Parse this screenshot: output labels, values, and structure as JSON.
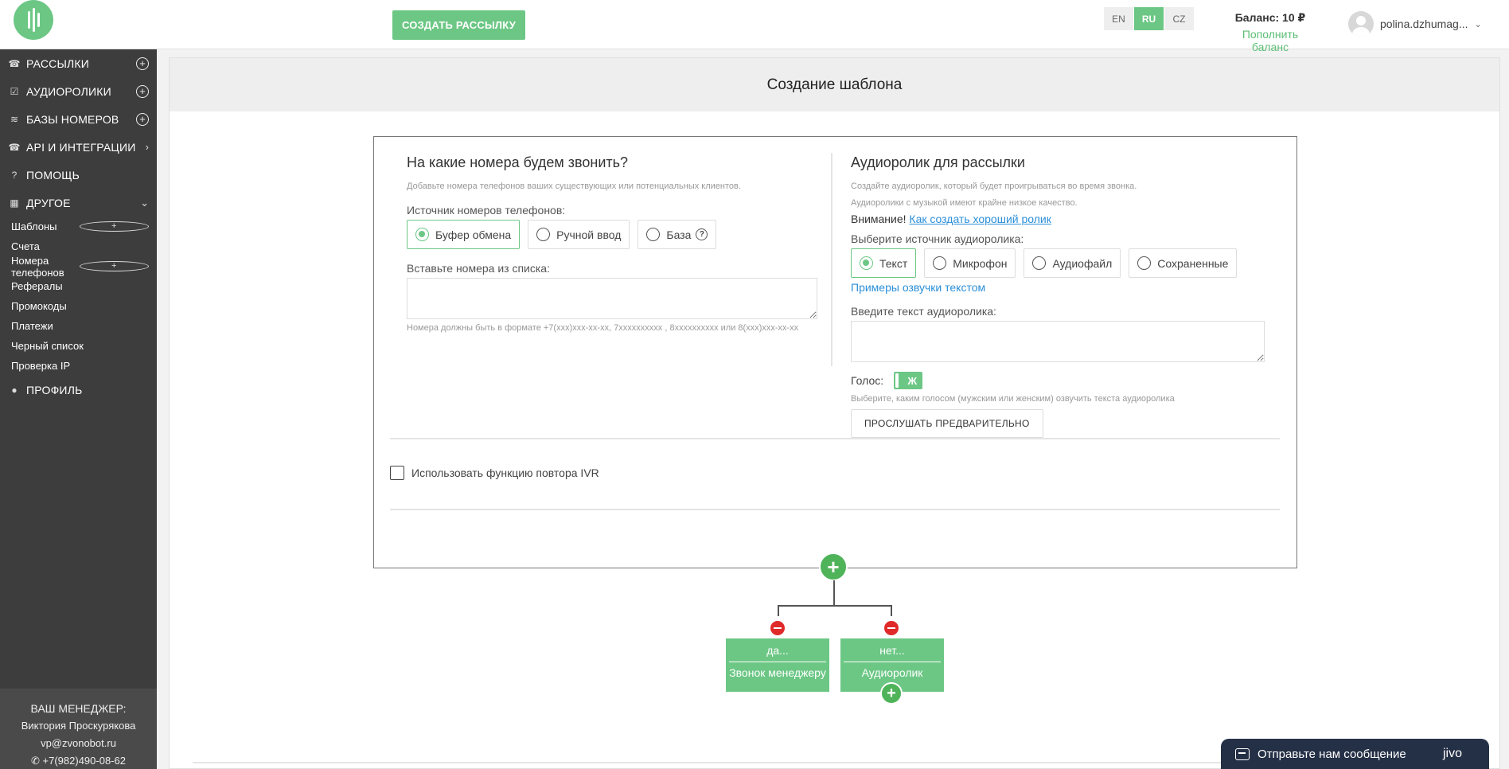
{
  "header": {
    "create_button": "СОЗДАТЬ РАССЫЛКУ",
    "languages": [
      "EN",
      "RU",
      "CZ"
    ],
    "active_language": "RU",
    "balance_label": "Баланс: 10 ₽",
    "topup_link": "Пополнить баланс",
    "user_name": "polina.dzhumag...",
    "accent_color": "#6cc785"
  },
  "sidebar": {
    "items": [
      {
        "label": "РАССЫЛКИ",
        "icon": "phone-icon"
      },
      {
        "label": "АУДИОРОЛИКИ",
        "icon": "edit-icon"
      },
      {
        "label": "БАЗЫ НОМЕРОВ",
        "icon": "database-icon"
      },
      {
        "label": "API И ИНТЕГРАЦИИ",
        "icon": "phone-icon"
      },
      {
        "label": "ПОМОЩЬ",
        "icon": "question-icon"
      },
      {
        "label": "ДРУГОЕ",
        "icon": "grid-icon"
      }
    ],
    "subitems": [
      "Шаблоны",
      "Счета",
      "Номера телефонов",
      "Рефералы",
      "Промокоды",
      "Платежи",
      "Черный список",
      "Проверка IP"
    ],
    "profile": "ПРОФИЛЬ",
    "manager": {
      "title": "ВАШ МЕНЕДЖЕР:",
      "name": "Виктория Проскурякова",
      "email": "vp@zvonobot.ru",
      "phone": "+7(982)490-08-62"
    }
  },
  "main": {
    "title": "Создание шаблона",
    "left": {
      "heading": "На какие номера будем звонить?",
      "hint": "Добавьте номера телефонов ваших существующих или потенциальных клиентов.",
      "source_label": "Источник номеров телефонов:",
      "sources": [
        "Буфер обмена",
        "Ручной ввод",
        "База"
      ],
      "paste_label": "Вставьте номера из списка:",
      "format_hint": "Номера должны быть в формате +7(xxx)xxx-xx-xx, 7xxxxxxxxxx , 8xxxxxxxxxx или 8(xxx)xxx-xx-xx"
    },
    "right": {
      "heading": "Аудиоролик для рассылки",
      "hint1": "Создайте аудиоролик, который будет проигрываться во время звонка.",
      "hint2": "Аудиоролики с музыкой имеют крайне низкое качество.",
      "warn_prefix": "Внимание!",
      "warn_link": "Как создать хороший ролик",
      "source_label": "Выберите источник аудиоролика:",
      "sources": [
        "Текст",
        "Микрофон",
        "Аудиофайл",
        "Сохраненные"
      ],
      "examples_link": "Примеры озвучки текстом",
      "text_label": "Введите текст аудиоролика:",
      "voice_label": "Голос:",
      "voice_value": "Ж",
      "voice_hint": "Выберите, каким голосом (мужским или женским) озвучить текста аудиоролика",
      "listen_button": "ПРОСЛУШАТЬ ПРЕДВАРИТЕЛЬНО"
    },
    "ivr_label": "Использовать функцию повтора IVR",
    "tree": {
      "nodes": [
        {
          "top": "да...",
          "bottom": "Звонок менеджеру"
        },
        {
          "top": "нет...",
          "bottom": "Аудиоролик"
        }
      ]
    }
  },
  "chat": {
    "text": "Отправьте нам сообщение",
    "brand": "jivo"
  }
}
